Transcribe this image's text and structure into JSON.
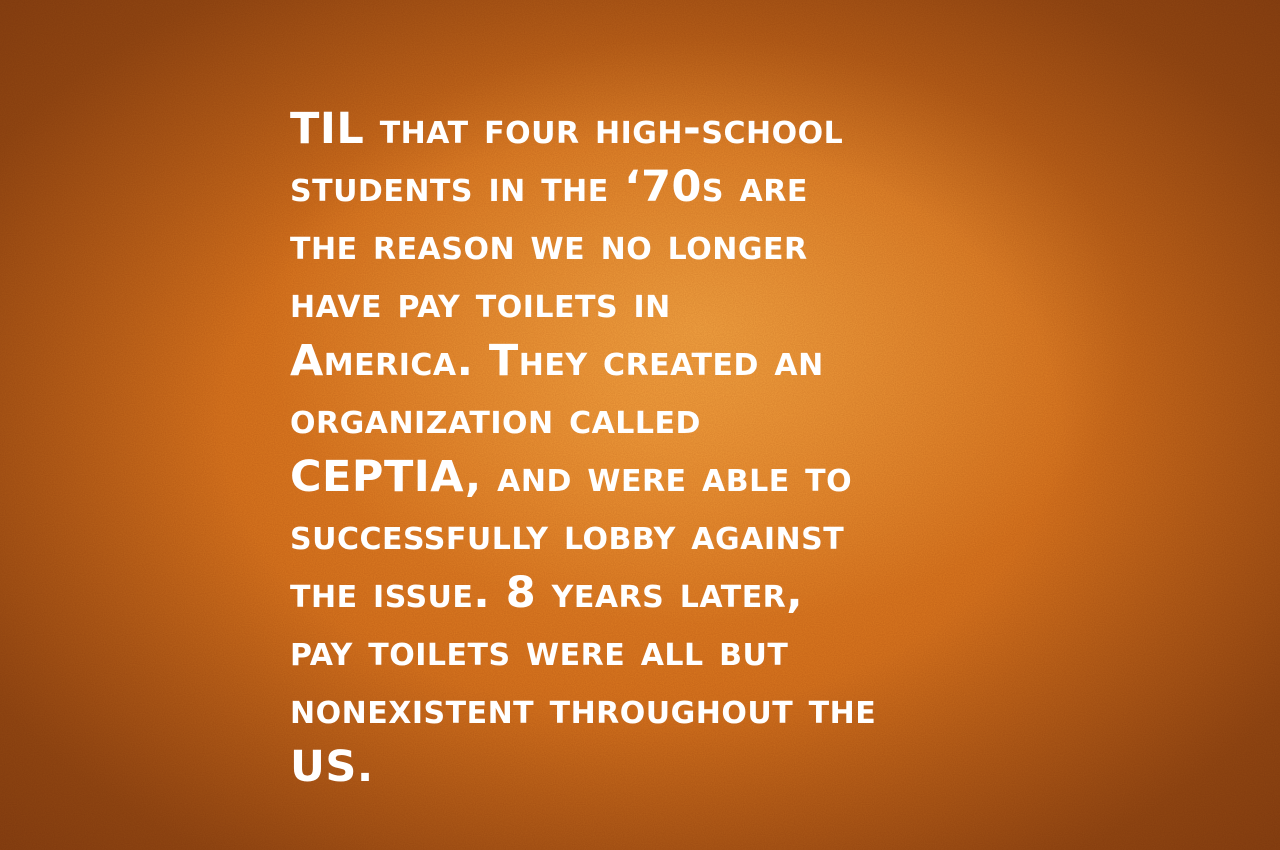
{
  "background": {
    "base_color": "#d9771f",
    "highlight_color": "#f3a547",
    "edge_color": "#a55418"
  },
  "text_color": "#ffffff",
  "quote": {
    "lines": [
      "TIL that four high-school",
      "students in the ‘70s are",
      "the reason we no longer",
      "have pay toilets in",
      "America. They created an",
      "organization called",
      "CEPTIA, and were able to",
      "successfully lobby against",
      "the issue. 8 years later,",
      "pay toilets were all but",
      "nonexistent throughout the",
      "US."
    ]
  }
}
